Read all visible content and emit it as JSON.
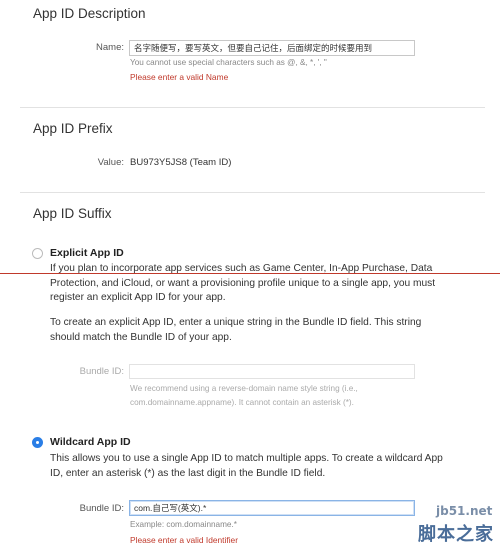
{
  "description": {
    "title": "App ID Description",
    "name_label": "Name:",
    "name_value": "名字随便写，要写英文，但要自己记住，后面绑定的时候要用到",
    "name_hint": "You cannot use special characters such as @, &, *, ', \"",
    "name_error": "Please enter a valid Name"
  },
  "prefix": {
    "title": "App ID Prefix",
    "value_label": "Value:",
    "value": "BU973Y5JS8 (Team ID)"
  },
  "suffix": {
    "title": "App ID Suffix",
    "explicit": {
      "title": "Explicit App ID",
      "selected": false,
      "para1_line1": "If you plan to incorporate app services such as Game Center, In-App Purchase, Data",
      "para1_line2": "Protection, and iCloud, or want a provisioning profile unique to a single app, you must",
      "para1_line3": "register an explicit App ID for your app.",
      "para2_line1": "To create an explicit App ID, enter a unique string in the Bundle ID field. This string",
      "para2_line2": "should match the Bundle ID of your app.",
      "bundle_label": "Bundle ID:",
      "bundle_value": "",
      "hint_line1": "We recommend using a reverse-domain name style string (i.e.,",
      "hint_line2": "com.domainname.appname). It cannot contain an asterisk (*)."
    },
    "wildcard": {
      "title": "Wildcard App ID",
      "selected": true,
      "para_line1": "This allows you to use a single App ID to match multiple apps. To create a wildcard App",
      "para_line2": "ID, enter an asterisk (*) as the last digit in the Bundle ID field.",
      "bundle_label": "Bundle ID:",
      "bundle_value": "com.自己写(英文).*",
      "example": "Example: com.domainname.*",
      "error": "Please enter a valid Identifier"
    }
  },
  "watermark": {
    "site": "jb51.net",
    "brand": "脚本之家"
  },
  "colors": {
    "accent": "#2a7ee6",
    "error": "#c0392b",
    "divider": "#e2e2e2"
  }
}
